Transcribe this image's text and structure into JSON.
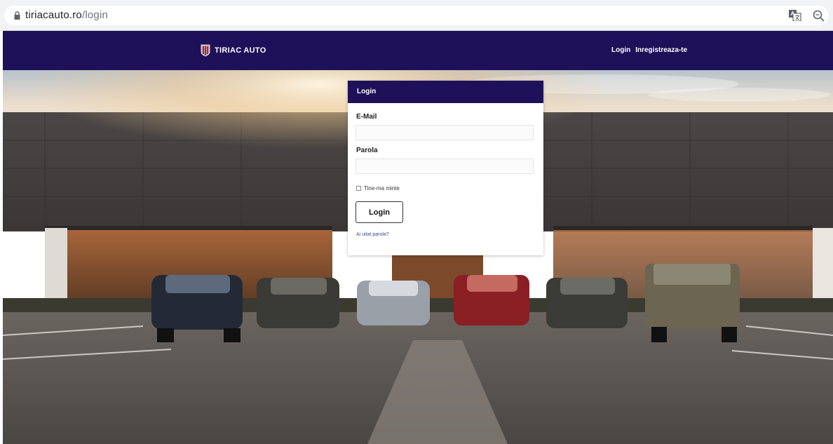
{
  "browser": {
    "url_host": "tiriacauto.ro",
    "url_path": "/login",
    "icons": [
      "lock-icon",
      "translate-icon",
      "zoom-icon"
    ]
  },
  "navbar": {
    "brand_text": "TIRIAC AUTO",
    "links": [
      "Login",
      "Inregistreaza-te"
    ],
    "background_color": "#1f1159"
  },
  "login_form": {
    "header": "Login",
    "email_label": "E-Mail",
    "email_value": "",
    "password_label": "Parola",
    "password_value": "",
    "remember_label": "Tine-ma minte",
    "remember_checked": false,
    "submit_label": "Login",
    "forgot_link": "Ai uitat parola?"
  },
  "colors": {
    "brand": "#1f1159",
    "page_bg": "#ffffff"
  }
}
